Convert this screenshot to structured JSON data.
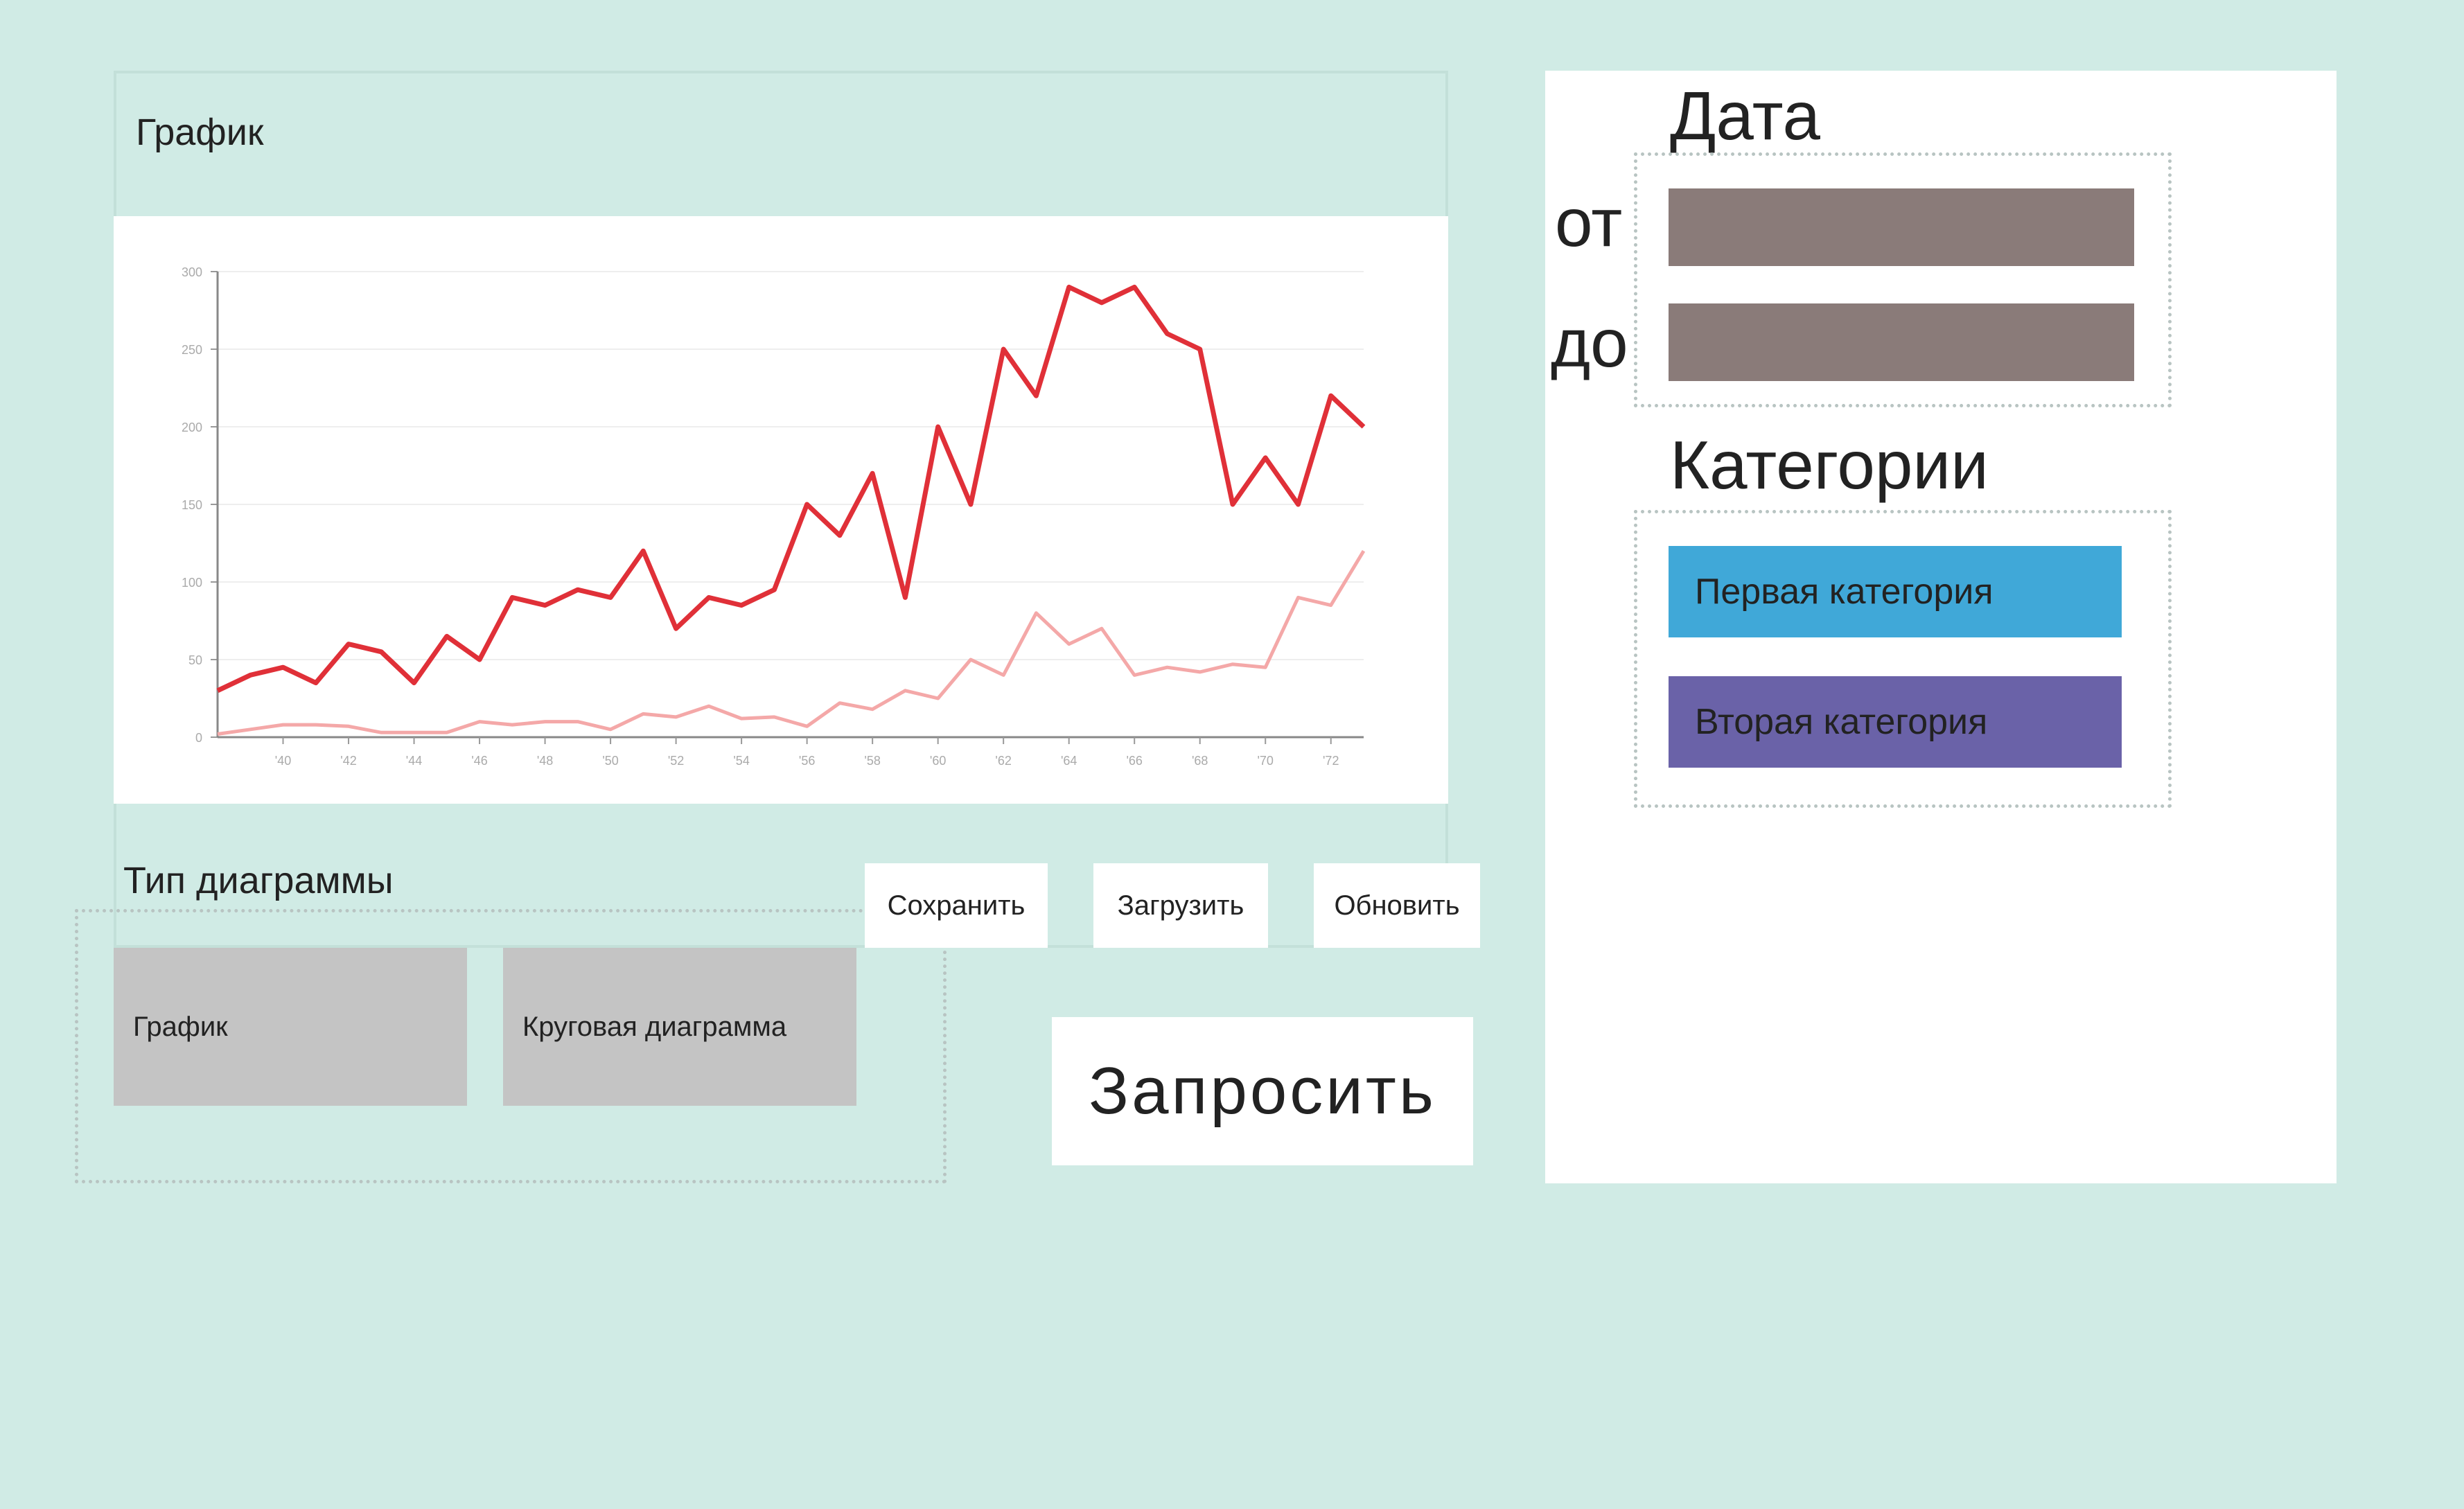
{
  "chart_panel": {
    "title": "График"
  },
  "chart_data": {
    "type": "line",
    "x_ticks": [
      "'40",
      "'42",
      "'44",
      "'46",
      "'48",
      "'50",
      "'52",
      "'54",
      "'56",
      "'58",
      "'60",
      "'62",
      "'64",
      "'66",
      "'68",
      "'70",
      "'72"
    ],
    "y_ticks": [
      "0",
      "50",
      "100",
      "150",
      "200",
      "250",
      "300"
    ],
    "ylim": [
      0,
      300
    ],
    "grid": true,
    "x": [
      1939,
      1940,
      1941,
      1942,
      1943,
      1944,
      1945,
      1946,
      1947,
      1948,
      1949,
      1950,
      1951,
      1952,
      1953,
      1954,
      1955,
      1956,
      1957,
      1958,
      1959,
      1960,
      1961,
      1962,
      1963,
      1964,
      1965,
      1966,
      1967,
      1968,
      1969,
      1970,
      1971,
      1972,
      1973
    ],
    "series": [
      {
        "color": "#e03038",
        "values": [
          30,
          40,
          45,
          35,
          60,
          55,
          35,
          65,
          50,
          90,
          85,
          95,
          90,
          120,
          70,
          90,
          85,
          95,
          150,
          130,
          170,
          90,
          200,
          150,
          250,
          220,
          290,
          280,
          290,
          260,
          250,
          150,
          180,
          150,
          220,
          200
        ]
      },
      {
        "color": "#f4a8a8",
        "values": [
          2,
          5,
          8,
          8,
          7,
          3,
          3,
          3,
          10,
          8,
          10,
          10,
          5,
          15,
          13,
          20,
          12,
          13,
          7,
          22,
          18,
          30,
          25,
          50,
          40,
          80,
          60,
          70,
          40,
          45,
          42,
          47,
          45,
          90,
          85,
          120
        ]
      }
    ]
  },
  "chart_type": {
    "label": "Тип диаграммы",
    "options": [
      "График",
      "Круговая диаграмма"
    ]
  },
  "actions": {
    "save": "Сохранить",
    "load": "Загрузить",
    "refresh": "Обновить",
    "request": "Запросить"
  },
  "filters": {
    "date_title": "Дата",
    "from_label": "от",
    "to_label": "до",
    "categories_title": "Категории",
    "categories": [
      {
        "label": "Первая категория",
        "color": "#40a8d8"
      },
      {
        "label": "Вторая категория",
        "color": "#6a62a8"
      }
    ]
  }
}
